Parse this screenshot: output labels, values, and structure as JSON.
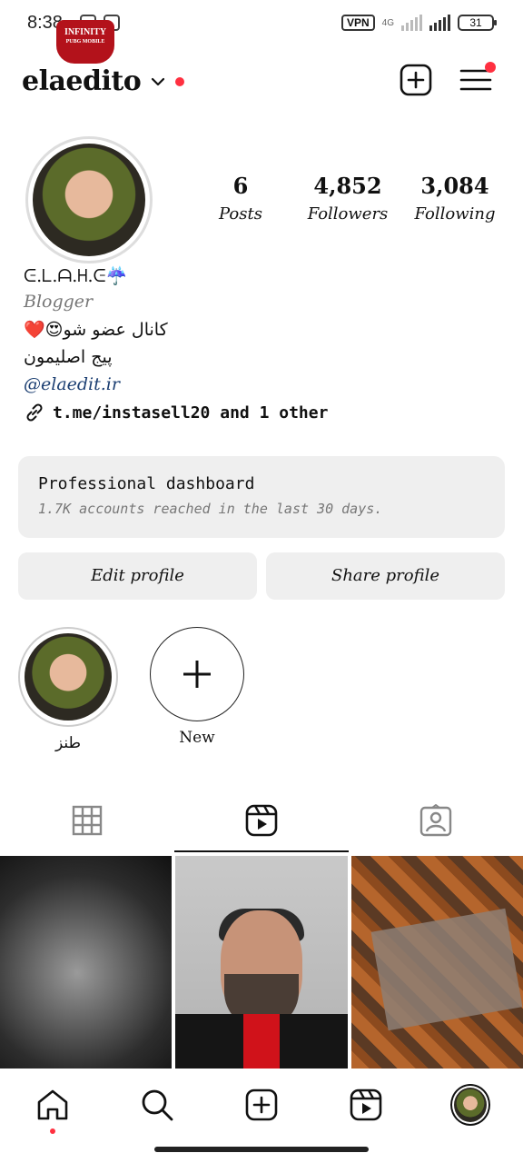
{
  "status_bar": {
    "time": "8:38",
    "vpn": "VPN",
    "net": "4G",
    "battery": "31"
  },
  "header": {
    "username": "elaedito",
    "logo_text": "INFINITY",
    "logo_sub": "PUBG MOBILE"
  },
  "stats": [
    {
      "num": "6",
      "label": "Posts"
    },
    {
      "num": "4,852",
      "label": "Followers"
    },
    {
      "num": "3,084",
      "label": "Following"
    }
  ],
  "bio": {
    "name": "ᕮ.ᒪ.ᗩ.ᕼ.ᕮ☔",
    "category": "Blogger",
    "line1": "کانال عضو شو😍❤️",
    "line2": "پیج اصلیمون",
    "handle": "@elaedit.ir",
    "link": "t.me/instasell20 and 1 other"
  },
  "dashboard": {
    "title": "Professional dashboard",
    "subtitle": "1.7K accounts reached in the last 30 days."
  },
  "buttons": {
    "edit": "Edit profile",
    "share": "Share profile"
  },
  "highlights": [
    {
      "label": "طنز"
    },
    {
      "label": "New"
    }
  ]
}
